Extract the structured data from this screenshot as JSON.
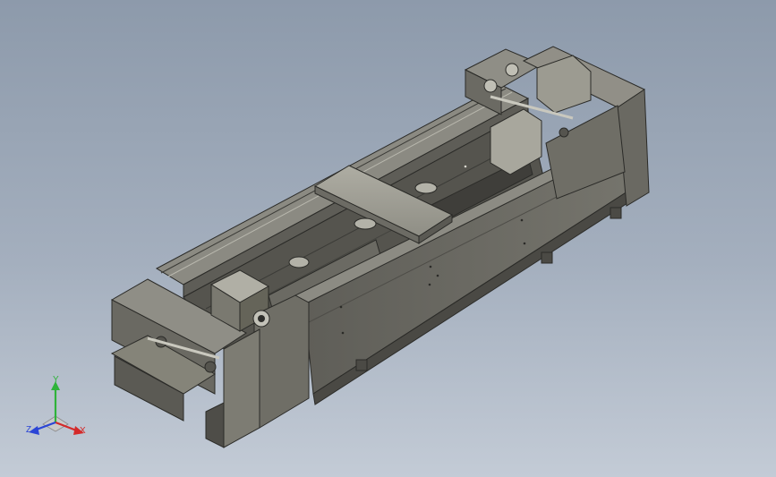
{
  "viewport": {
    "background_top": "#8d9aab",
    "background_bottom": "#c3cbd6"
  },
  "model": {
    "body_color": "#6f6e66",
    "top_color": "#9a998f",
    "edge_color": "#2b2b28"
  },
  "triad": {
    "y_label": "Y",
    "z_label": "Z",
    "x_label": "X",
    "y_color": "#2fb33a",
    "z_color": "#2b45d6",
    "x_color": "#d42a2a"
  }
}
